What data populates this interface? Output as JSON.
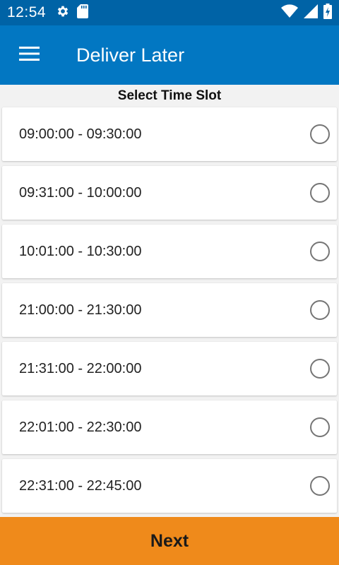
{
  "status_bar": {
    "time": "12:54",
    "icons_left": [
      "gear-icon",
      "sd-card-icon"
    ],
    "icons_right": [
      "wifi-icon",
      "cell-signal-icon",
      "battery-charging-icon"
    ]
  },
  "app_bar": {
    "title": "Deliver Later",
    "menu_icon": "hamburger-menu-icon"
  },
  "section": {
    "title": "Select Time Slot"
  },
  "time_slots": [
    {
      "label": "09:00:00 - 09:30:00",
      "selected": false
    },
    {
      "label": "09:31:00 - 10:00:00",
      "selected": false
    },
    {
      "label": "10:01:00 - 10:30:00",
      "selected": false
    },
    {
      "label": "21:00:00 - 21:30:00",
      "selected": false
    },
    {
      "label": "21:31:00 - 22:00:00",
      "selected": false
    },
    {
      "label": "22:01:00 - 22:30:00",
      "selected": false
    },
    {
      "label": "22:31:00 - 22:45:00",
      "selected": false
    }
  ],
  "footer": {
    "next_label": "Next"
  },
  "colors": {
    "status_bar": "#0063a6",
    "app_bar": "#0277c2",
    "next_button": "#ef8a1b"
  }
}
